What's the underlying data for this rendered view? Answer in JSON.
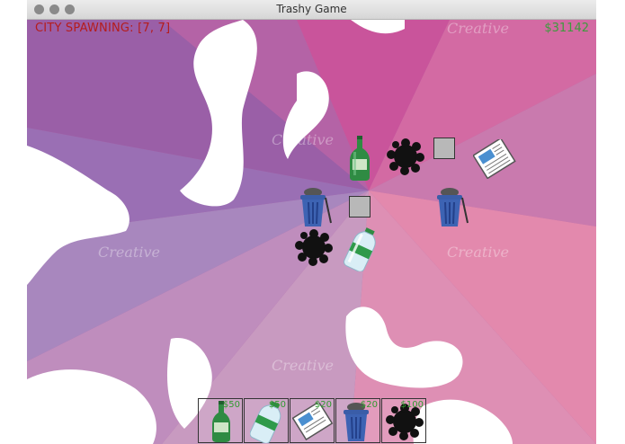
{
  "window": {
    "title": "Trashy Game"
  },
  "hud": {
    "city_spawning": "CITY SPAWNING: [7, 7]",
    "money": "$31142"
  },
  "watermark": "Creative",
  "colors": {
    "money": "#3e9b3e",
    "spawn_text": "#b51c1c",
    "bg_main": "#b86aa8",
    "bg_pink": "#e07aa8"
  },
  "board_items": [
    {
      "kind": "bottle-green"
    },
    {
      "kind": "splat"
    },
    {
      "kind": "gray-tile"
    },
    {
      "kind": "newspaper"
    },
    {
      "kind": "trash-can"
    },
    {
      "kind": "gray-tile"
    },
    {
      "kind": "trash-can"
    },
    {
      "kind": "splat"
    },
    {
      "kind": "bottle-plastic"
    }
  ],
  "shop": {
    "items": [
      {
        "name": "green-bottle",
        "price": "$50"
      },
      {
        "name": "plastic-bottle",
        "price": "$50"
      },
      {
        "name": "newspaper",
        "price": "$20"
      },
      {
        "name": "trash-can",
        "price": "$20"
      },
      {
        "name": "splat",
        "price": "$100"
      }
    ]
  }
}
